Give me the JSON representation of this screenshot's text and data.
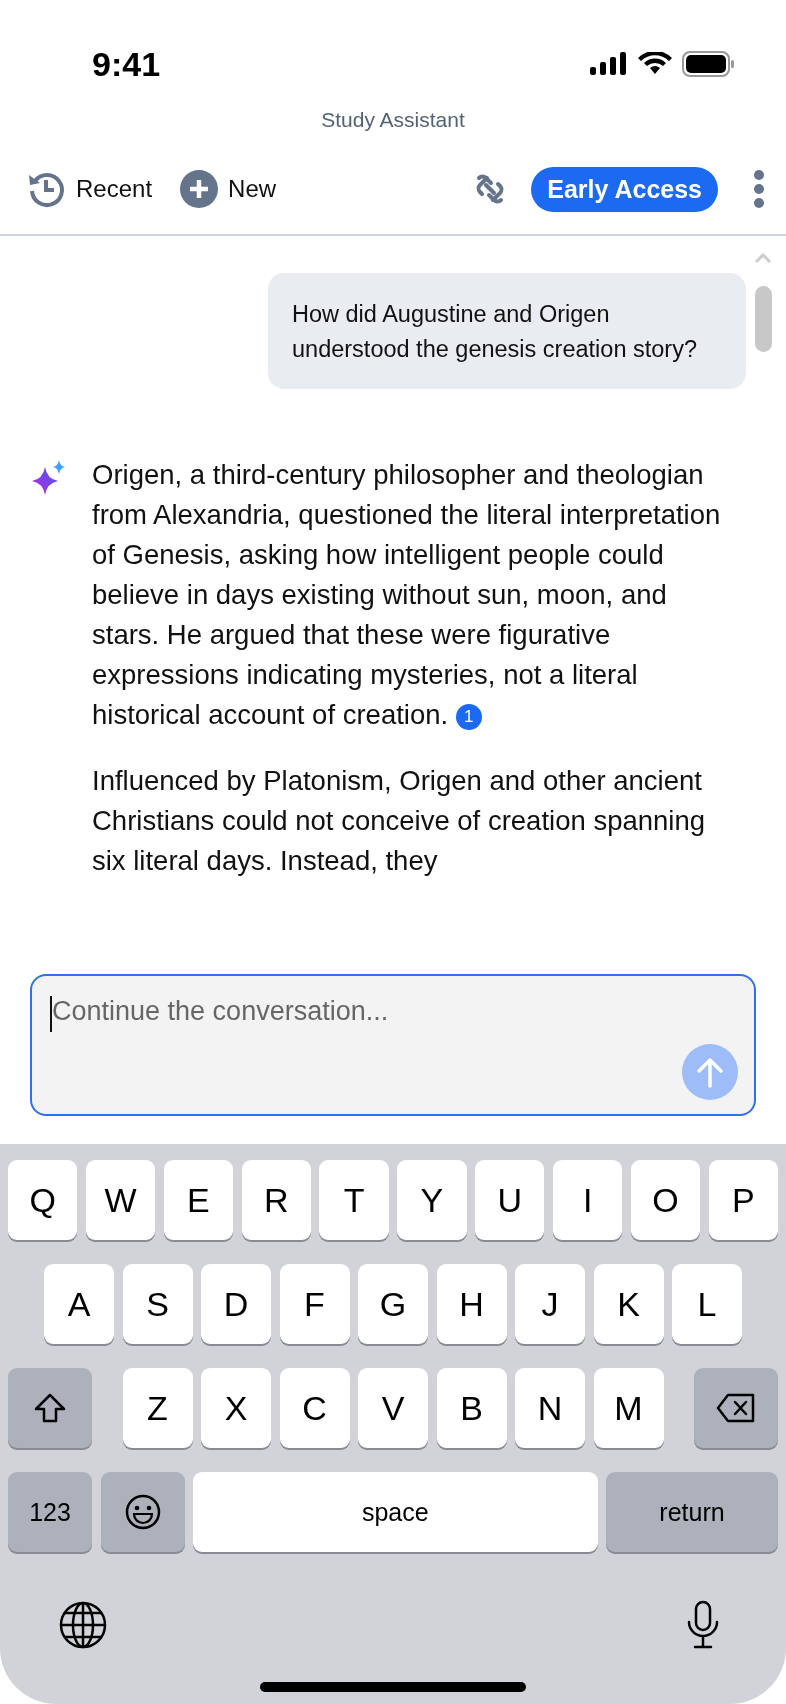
{
  "status_bar": {
    "time": "9:41"
  },
  "header": {
    "title": "Study Assistant"
  },
  "toolbar": {
    "recent": "Recent",
    "new": "New",
    "badge": "Early Access"
  },
  "conversation": {
    "user_message": {
      "text": "How did Augustine and Origen understood the genesis creation story?"
    },
    "assistant_reply": {
      "paragraphs": [
        {
          "text": "Origen, a third-century philosopher and theologian from Alexandria, questioned the literal interpretation of Genesis, asking how intelligent people could believe in days existing without sun, moon, and stars. He argued that these were figurative expressions indicating mysteries, not a literal historical account of creation.",
          "citation": "1"
        },
        {
          "text": "Influenced by Platonism, Origen and other ancient Christians could not conceive of creation spanning six literal days. Instead, they"
        }
      ]
    }
  },
  "composer": {
    "placeholder": "Continue the conversation..."
  },
  "keyboard": {
    "top_row": [
      {
        "kind": "letter",
        "label": "Q"
      },
      {
        "kind": "letter",
        "label": "W"
      },
      {
        "kind": "letter",
        "label": "E"
      },
      {
        "kind": "letter",
        "label": "R"
      },
      {
        "kind": "letter",
        "label": "T"
      },
      {
        "kind": "letter",
        "label": "Y"
      },
      {
        "kind": "letter",
        "label": "U"
      },
      {
        "kind": "letter",
        "label": "I"
      },
      {
        "kind": "letter",
        "label": "O"
      },
      {
        "kind": "letter",
        "label": "P"
      }
    ],
    "middle_row": [
      {
        "kind": "letter",
        "label": "A"
      },
      {
        "kind": "letter",
        "label": "S"
      },
      {
        "kind": "letter",
        "label": "D"
      },
      {
        "kind": "letter",
        "label": "F"
      },
      {
        "kind": "letter",
        "label": "G"
      },
      {
        "kind": "letter",
        "label": "H"
      },
      {
        "kind": "letter",
        "label": "J"
      },
      {
        "kind": "letter",
        "label": "K"
      },
      {
        "kind": "letter",
        "label": "L"
      }
    ],
    "bottom_row": [
      {
        "kind": "shift"
      },
      {
        "kind": "letter",
        "label": "Z"
      },
      {
        "kind": "letter",
        "label": "X"
      },
      {
        "kind": "letter",
        "label": "C"
      },
      {
        "kind": "letter",
        "label": "V"
      },
      {
        "kind": "letter",
        "label": "B"
      },
      {
        "kind": "letter",
        "label": "N"
      },
      {
        "kind": "letter",
        "label": "M"
      },
      {
        "kind": "backspace"
      }
    ],
    "function_row": [
      {
        "kind": "numbers",
        "label": "123"
      },
      {
        "kind": "emoji"
      },
      {
        "kind": "space",
        "label": "space"
      },
      {
        "kind": "return",
        "label": "return"
      }
    ]
  }
}
